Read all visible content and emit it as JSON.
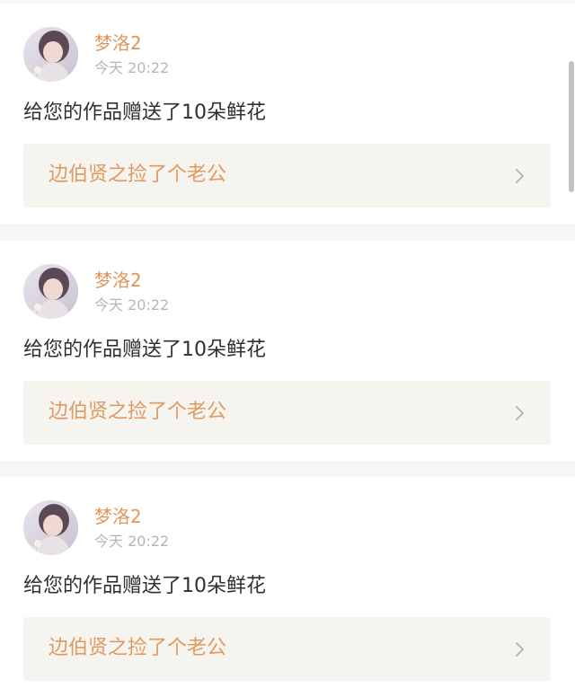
{
  "notifications": [
    {
      "username": "梦洛2",
      "time": "今天 20:22",
      "message": "给您的作品赠送了10朵鲜花",
      "work_title": "边伯贤之捡了个老公"
    },
    {
      "username": "梦洛2",
      "time": "今天 20:22",
      "message": "给您的作品赠送了10朵鲜花",
      "work_title": "边伯贤之捡了个老公"
    },
    {
      "username": "梦洛2",
      "time": "今天 20:22",
      "message": "给您的作品赠送了10朵鲜花",
      "work_title": "边伯贤之捡了个老公"
    }
  ],
  "icons": {
    "avatar": "user-avatar-icon",
    "chevron": "chevron-right-icon"
  },
  "colors": {
    "username": "#e1955a",
    "work_title": "#e09a61",
    "time": "#b5b5b5",
    "message": "#2f2f2f",
    "link_background": "#f5f4ef",
    "page_background": "#f7f5f5"
  }
}
